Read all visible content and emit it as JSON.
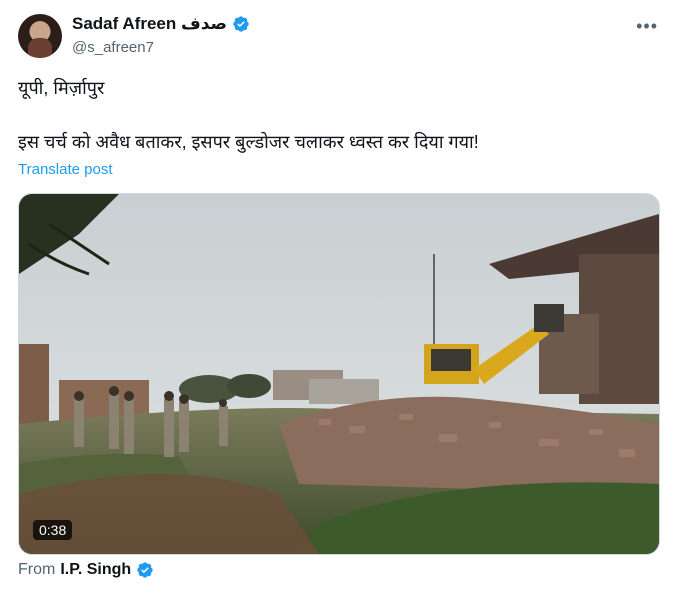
{
  "author": {
    "display_name": "Sadaf Afreen صدف",
    "handle": "@s_afreen7",
    "verified_icon": "verified-badge-icon",
    "avatar_icon": "avatar"
  },
  "post": {
    "line1": "यूपी, मिर्ज़ापुर",
    "line2": "इस चर्च को अवैध बताकर, इसपर बुल्डोजर चलाकर ध्वस्त कर दिया गया!",
    "translate_label": "Translate post"
  },
  "media": {
    "duration": "0:38"
  },
  "attribution": {
    "prefix": "From",
    "name": "I.P. Singh",
    "verified_icon": "verified-badge-icon"
  },
  "colors": {
    "accent": "#1d9bf0",
    "secondary_text": "#536471"
  }
}
